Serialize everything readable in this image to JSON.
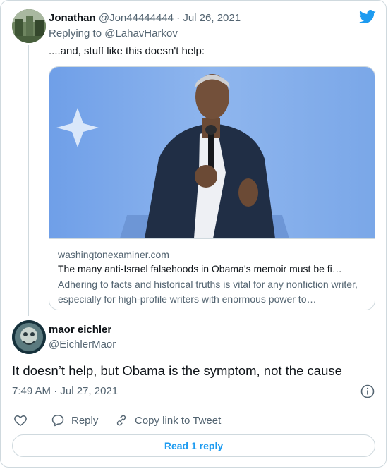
{
  "colors": {
    "accent": "#1d9bf0",
    "secondary_text": "#536471",
    "border": "#cfd9de"
  },
  "original_tweet": {
    "display_name": "Jonathan",
    "handle_date": "@Jon44444444 · Jul 26, 2021",
    "replying_to": "Replying to @LahavHarkov",
    "text": "....and, stuff like this doesn't help:",
    "link_card": {
      "domain": "washingtonexaminer.com",
      "title": "The many anti-Israel falsehoods in Obama’s memoir must be fi…",
      "description": "Adhering to facts and historical truths is vital for any nonfiction writer, especially for high-profile writers with enormous power to…"
    }
  },
  "tweet": {
    "display_name": "maor eichler",
    "handle": "@EichlerMaor",
    "text": "It doesn’t help, but Obama is the symptom, not the cause",
    "timestamp": "7:49 AM · Jul 27, 2021"
  },
  "actions": {
    "reply_label": "Reply",
    "copy_link_label": "Copy link to Tweet",
    "read_replies_label": "Read 1 reply"
  },
  "icons": [
    "twitter-bird-icon",
    "info-icon",
    "heart-icon",
    "reply-icon",
    "link-icon"
  ]
}
